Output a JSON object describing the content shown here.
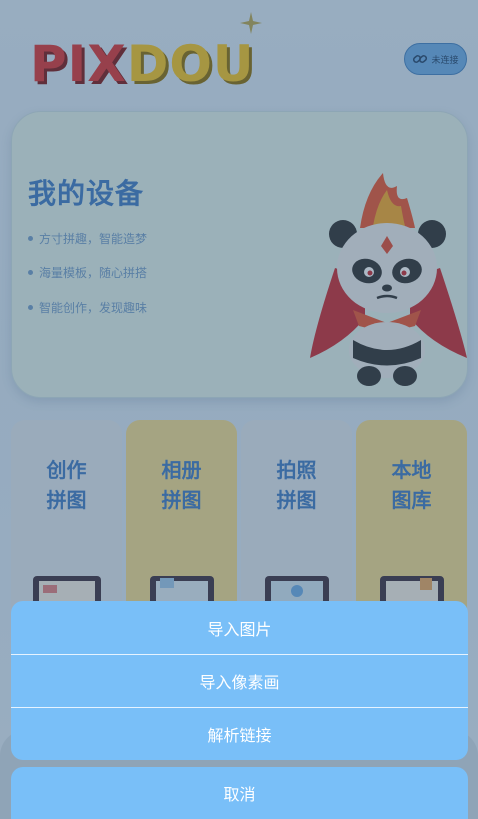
{
  "header": {
    "logo_part1": "PIX",
    "logo_part2": "DOU",
    "connect_label": "未连接",
    "connect_icon": "link-icon"
  },
  "device_card": {
    "title": "我的设备",
    "features": [
      "方寸拼趣，智能造梦",
      "海量模板，随心拼搭",
      "智能创作，发现趣味"
    ]
  },
  "modes": [
    {
      "line1": "创作",
      "line2": "拼图"
    },
    {
      "line1": "相册",
      "line2": "拼图"
    },
    {
      "line1": "拍照",
      "line2": "拼图"
    },
    {
      "line1": "本地",
      "line2": "图库"
    }
  ],
  "action_sheet": {
    "items": [
      "导入图片",
      "导入像素画",
      "解析链接"
    ],
    "cancel": "取消"
  },
  "colors": {
    "accent": "#3b78c2",
    "sheet": "#79bff8",
    "logo_red": "#d92e2e",
    "logo_yellow": "#f3c21c"
  }
}
